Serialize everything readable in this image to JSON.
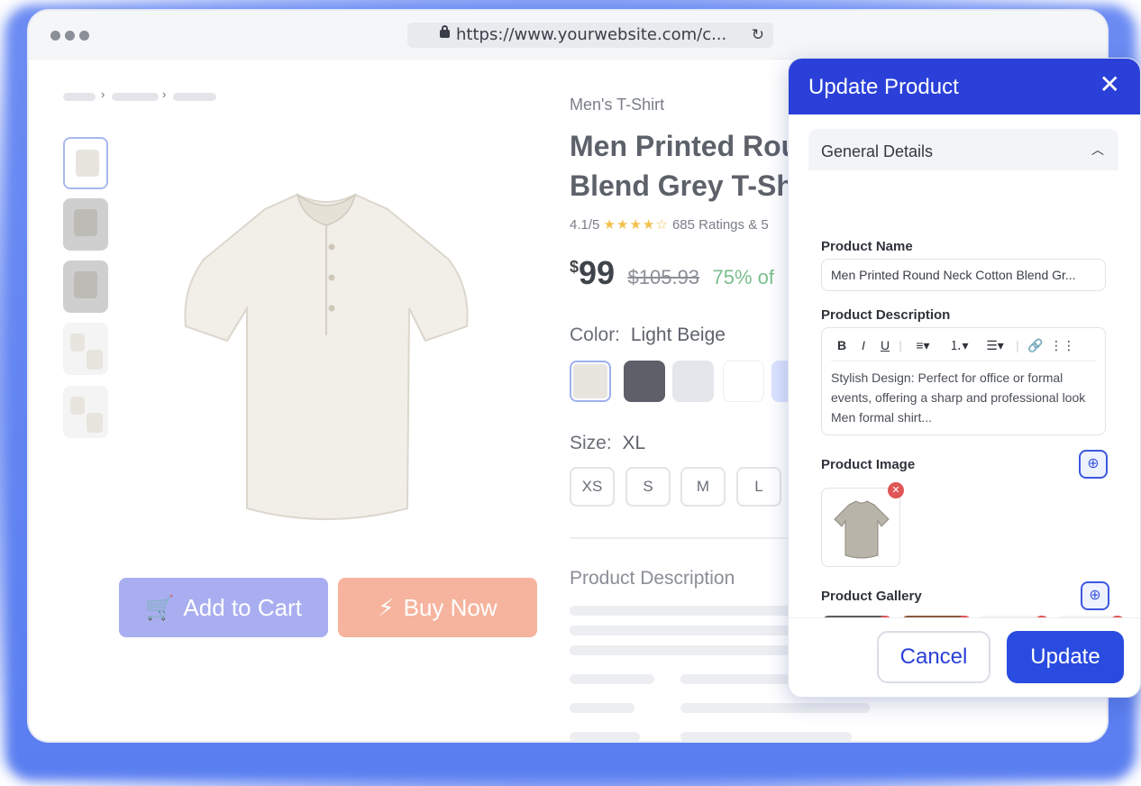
{
  "browser": {
    "url": "https://www.yourwebsite.com/c...",
    "reload_icon": "reload-icon",
    "lock_icon": "lock-icon"
  },
  "product": {
    "category": "Men's T-Shirt",
    "title_line1": "Men Printed Rou",
    "title_line2": "Blend Grey T-Sh",
    "rating": "4.1/5",
    "rating_stars": "★★★★☆",
    "ratings_count": "685 Ratings & 5",
    "currency_symbol": "$",
    "price": "99",
    "old_price": "$105.93",
    "discount": "75% of",
    "color_label": "Color:",
    "color_value": "Light Beige",
    "colors": [
      "#e8e5df",
      "#5d6068",
      "#e3e7ec",
      "#ffffff",
      "#dbe3ff"
    ],
    "size_label": "Size:",
    "size_value": "XL",
    "sizes": [
      "XS",
      "S",
      "M",
      "L"
    ],
    "description_heading": "Product Description",
    "add_to_cart": "Add to Cart",
    "buy_now": "Buy Now"
  },
  "modal": {
    "title": "Update Product",
    "close_icon": "close-icon",
    "section_title": "General Details",
    "name_label": "Product Name",
    "name_value": "Men Printed Round Neck Cotton Blend Gr...",
    "description_label": "Product Description",
    "toolbar": [
      "B",
      "I",
      "U",
      "≡▾",
      "⒈▾",
      "☰▾",
      "🔗",
      "⋮⋮"
    ],
    "description_value": "Stylish Design: Perfect for office or formal events, offering a sharp and professional look Men formal shirt...",
    "image_label": "Product Image",
    "gallery_label": "Product Gallery",
    "cancel": "Cancel",
    "update": "Update"
  }
}
